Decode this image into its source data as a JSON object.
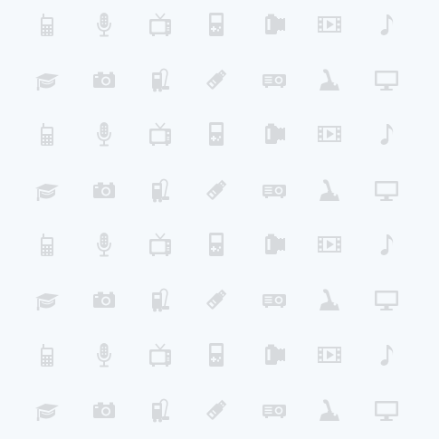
{
  "background": "#f5f9fc",
  "icon_color": "#d7dadd",
  "pattern": {
    "rows": [
      [
        "mobile-phone-icon",
        "microphone-icon",
        "television-icon",
        "handheld-game-icon",
        "film-roll-icon",
        "film-strip-icon",
        "music-note-icon"
      ],
      [
        "graduation-cap-icon",
        "camera-icon",
        "vacuum-cleaner-icon",
        "usb-stick-icon",
        "projector-icon",
        "joystick-icon",
        "monitor-icon"
      ],
      [
        "mobile-phone-icon",
        "microphone-icon",
        "television-icon",
        "handheld-game-icon",
        "film-roll-icon",
        "film-strip-icon",
        "music-note-icon"
      ],
      [
        "graduation-cap-icon",
        "camera-icon",
        "vacuum-cleaner-icon",
        "usb-stick-icon",
        "projector-icon",
        "joystick-icon",
        "monitor-icon"
      ],
      [
        "mobile-phone-icon",
        "microphone-icon",
        "television-icon",
        "handheld-game-icon",
        "film-roll-icon",
        "film-strip-icon",
        "music-note-icon"
      ],
      [
        "graduation-cap-icon",
        "camera-icon",
        "vacuum-cleaner-icon",
        "usb-stick-icon",
        "projector-icon",
        "joystick-icon",
        "monitor-icon"
      ],
      [
        "mobile-phone-icon",
        "microphone-icon",
        "television-icon",
        "handheld-game-icon",
        "film-roll-icon",
        "film-strip-icon",
        "music-note-icon"
      ],
      [
        "graduation-cap-icon",
        "camera-icon",
        "vacuum-cleaner-icon",
        "usb-stick-icon",
        "projector-icon",
        "joystick-icon",
        "monitor-icon"
      ]
    ]
  }
}
